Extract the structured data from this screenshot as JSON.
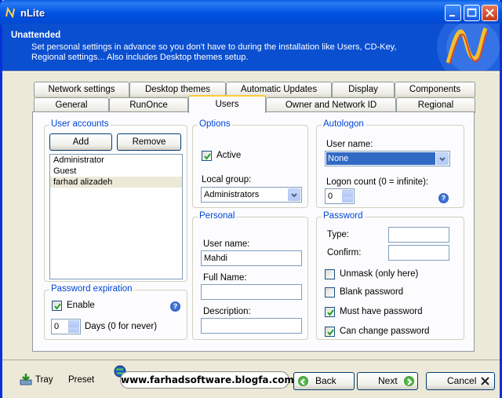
{
  "window": {
    "title": "nLite"
  },
  "header": {
    "title": "Unattended",
    "description": "Set personal settings in advance so you don't have to during the installation like Users, CD-Key, Regional settings... Also includes Desktop themes setup."
  },
  "tabs": {
    "row1": [
      "Network settings",
      "Desktop themes",
      "Automatic Updates",
      "Display",
      "Components"
    ],
    "row2": [
      "General",
      "RunOnce",
      "Users",
      "Owner and Network ID",
      "Regional"
    ],
    "active": "Users"
  },
  "user_accounts": {
    "title": "User accounts",
    "add_label": "Add",
    "remove_label": "Remove",
    "items": [
      "Administrator",
      "Guest",
      "farhad alizadeh"
    ]
  },
  "password_expiration": {
    "title": "Password expiration",
    "enable_label": "Enable",
    "enable_checked": true,
    "days_value": "0",
    "days_label": "Days (0 for never)"
  },
  "options": {
    "title": "Options",
    "active_label": "Active",
    "active_checked": true,
    "local_group_label": "Local group:",
    "local_group_value": "Administrators"
  },
  "personal": {
    "title": "Personal",
    "username_label": "User name:",
    "username_value": "Mahdi",
    "fullname_label": "Full Name:",
    "fullname_value": "",
    "description_label": "Description:",
    "description_value": ""
  },
  "autologon": {
    "title": "Autologon",
    "username_label": "User name:",
    "username_value": "None",
    "logon_count_label": "Logon count (0 = infinite):",
    "logon_count_value": "0"
  },
  "password": {
    "title": "Password",
    "type_label": "Type:",
    "confirm_label": "Confirm:",
    "unmask_label": "Unmask (only here)",
    "unmask_checked": false,
    "blank_label": "Blank password",
    "blank_checked": false,
    "must_have_label": "Must have password",
    "must_have_checked": true,
    "can_change_label": "Can change password",
    "can_change_checked": true
  },
  "footer": {
    "tray_label": "Tray",
    "preset_label": "Preset",
    "url": "www.farhadsoftware.blogfa.com",
    "back_label": "Back",
    "next_label": "Next",
    "cancel_label": "Cancel"
  }
}
